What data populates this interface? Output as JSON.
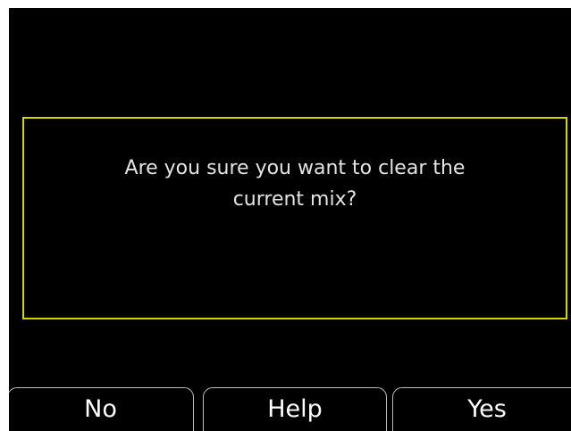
{
  "dialog": {
    "message_line1": "Are you sure you want to clear the",
    "message_line2": "current mix?"
  },
  "softkeys": {
    "no_label": "No",
    "help_label": "Help",
    "yes_label": "Yes"
  },
  "colors": {
    "screen_background": "#000000",
    "dialog_border": "#d8d400",
    "text": "#e4e4e4",
    "softkey_border": "#bdbdbd"
  }
}
